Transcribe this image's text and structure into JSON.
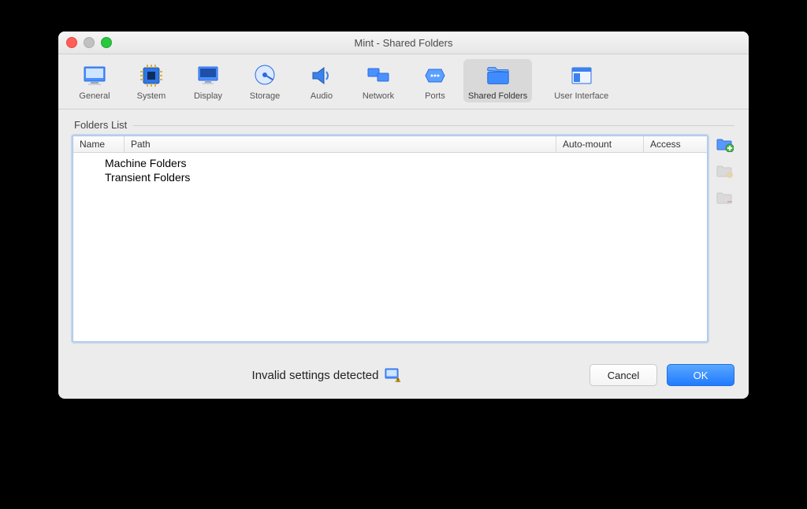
{
  "window": {
    "title": "Mint - Shared Folders"
  },
  "toolbar": {
    "items": [
      {
        "id": "general",
        "label": "General"
      },
      {
        "id": "system",
        "label": "System"
      },
      {
        "id": "display",
        "label": "Display"
      },
      {
        "id": "storage",
        "label": "Storage"
      },
      {
        "id": "audio",
        "label": "Audio"
      },
      {
        "id": "network",
        "label": "Network"
      },
      {
        "id": "ports",
        "label": "Ports"
      },
      {
        "id": "shared-folders",
        "label": "Shared Folders",
        "selected": true
      },
      {
        "id": "user-interface",
        "label": "User Interface"
      }
    ]
  },
  "group": {
    "label": "Folders List"
  },
  "table": {
    "columns": {
      "name": "Name",
      "path": "Path",
      "auto": "Auto-mount",
      "access": "Access"
    },
    "rows": [
      {
        "label": "Machine Folders"
      },
      {
        "label": "Transient Folders"
      }
    ]
  },
  "sideButtons": {
    "add": "add-folder",
    "edit": "edit-folder",
    "remove": "remove-folder"
  },
  "status": {
    "text": "Invalid settings detected"
  },
  "buttons": {
    "cancel": "Cancel",
    "ok": "OK"
  }
}
